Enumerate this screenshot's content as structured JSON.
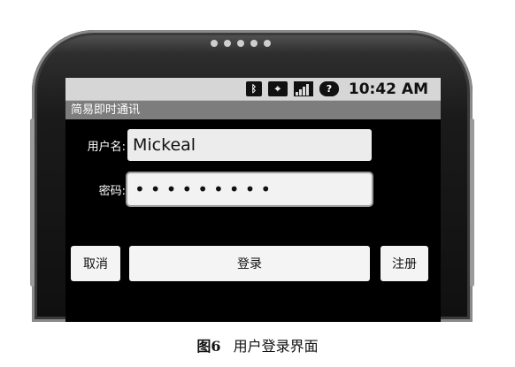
{
  "status_bar": {
    "icons": [
      "bluetooth-icon",
      "gps-icon",
      "signal-icon",
      "battery-icon"
    ],
    "time": "10:42 AM"
  },
  "app": {
    "title": "简易即时通讯"
  },
  "form": {
    "username_label": "用户名:",
    "username_value": "Mickeal",
    "password_label": "密码:",
    "password_value": "•••••••••"
  },
  "buttons": {
    "cancel": "取消",
    "login": "登录",
    "register": "注册"
  },
  "caption": {
    "figure": "图6",
    "text": "用户登录界面"
  }
}
